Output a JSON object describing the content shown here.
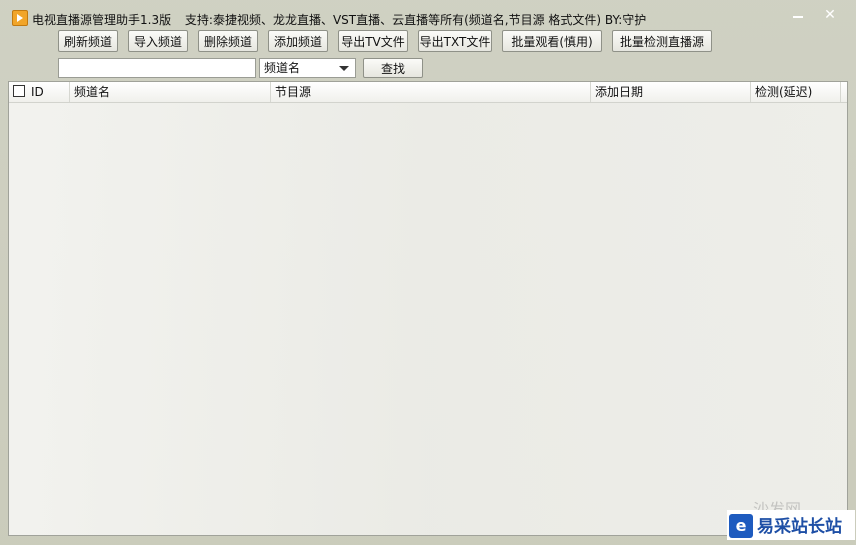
{
  "window": {
    "title": "电视直播源管理助手1.3版",
    "subtitle": "支持:泰捷视频、龙龙直播、VST直播、云直播等所有(频道名,节目源  格式文件)  BY:守护",
    "close_glyph": "✕"
  },
  "toolbar": {
    "refresh": "刷新频道",
    "import": "导入频道",
    "delete": "删除频道",
    "add": "添加频道",
    "export_tv": "导出TV文件",
    "export_txt": "导出TXT文件",
    "batch_watch": "批量观看(慎用)",
    "batch_check": "批量检测直播源"
  },
  "search": {
    "value": "",
    "field_selected": "频道名",
    "find_label": "查找"
  },
  "table": {
    "columns": [
      "ID",
      "频道名",
      "节目源",
      "添加日期",
      "检测(延迟)"
    ],
    "rows": []
  },
  "watermark": {
    "faint": "沙发网",
    "logo_letter": "e",
    "text": "易采站长站"
  },
  "colors": {
    "app_icon": "#f1a52a",
    "watermark_blue": "#1e5bbf"
  }
}
